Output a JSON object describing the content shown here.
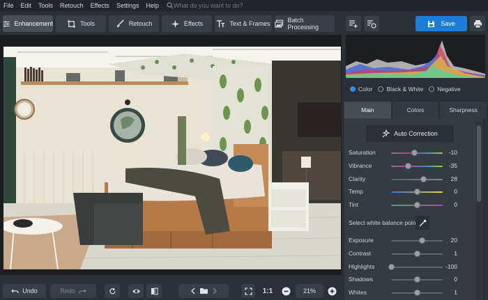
{
  "menu": [
    "File",
    "Edit",
    "Tools",
    "Retouch",
    "Effects",
    "Settings",
    "Help"
  ],
  "search": {
    "placeholder": "What do you want to do?",
    "icon": "search-icon"
  },
  "tabs": [
    {
      "label": "Enhancement",
      "icon": "sliders-icon",
      "active": true
    },
    {
      "label": "Tools",
      "icon": "crop-icon"
    },
    {
      "label": "Retouch",
      "icon": "brush-icon"
    },
    {
      "label": "Effects",
      "icon": "sparkle-icon"
    },
    {
      "label": "Text & Frames",
      "icon": "text-icon"
    },
    {
      "label": "Batch Processing",
      "icon": "batch-icon"
    }
  ],
  "save_label": "Save",
  "mode": {
    "options": [
      "Color",
      "Black & White",
      "Negative"
    ],
    "selected": "Color"
  },
  "panel_tabs": [
    "Main",
    "Colors",
    "Sharpness"
  ],
  "panel_tab_active": "Main",
  "auto_correction": "Auto Correction",
  "sliders_top": [
    {
      "label": "Saturation",
      "value": "-10",
      "level": 0.45,
      "gradient": [
        "#7d7d7d",
        "#c03b8c",
        "#3b8cc0",
        "#9ad23b"
      ]
    },
    {
      "label": "Vibrance",
      "value": "-35",
      "level": 0.33,
      "gradient": [
        "#7d7d7d",
        "#c03b8c",
        "#3b8cc0",
        "#9ad23b"
      ]
    },
    {
      "label": "Clarity",
      "value": "28",
      "level": 0.63,
      "gradient": [
        "#5b5f66",
        "#7f858c"
      ]
    },
    {
      "label": "Temp",
      "value": "0",
      "level": 0.5,
      "gradient": [
        "#3b6fd6",
        "#e6d23b"
      ]
    },
    {
      "label": "Tint",
      "value": "0",
      "level": 0.5,
      "gradient": [
        "#3bb84b",
        "#c83bb8"
      ]
    }
  ],
  "wb_label": "Select white balance point",
  "sliders_bottom": [
    {
      "label": "Exposure",
      "value": "20",
      "level": 0.6
    },
    {
      "label": "Contrast",
      "value": "1",
      "level": 0.51
    },
    {
      "label": "Highlights",
      "value": "-100",
      "level": 0.0
    },
    {
      "label": "Shadows",
      "value": "0",
      "level": 0.5
    },
    {
      "label": "Whites",
      "value": "1",
      "level": 0.51
    }
  ],
  "bottom": {
    "undo": "Undo",
    "redo": "Redo",
    "zoom_actual": "1:1",
    "zoom_level": "21%"
  },
  "colors": {
    "accent": "#1c7ed6",
    "panel": "#363b42",
    "bg": "#2b2f36"
  }
}
